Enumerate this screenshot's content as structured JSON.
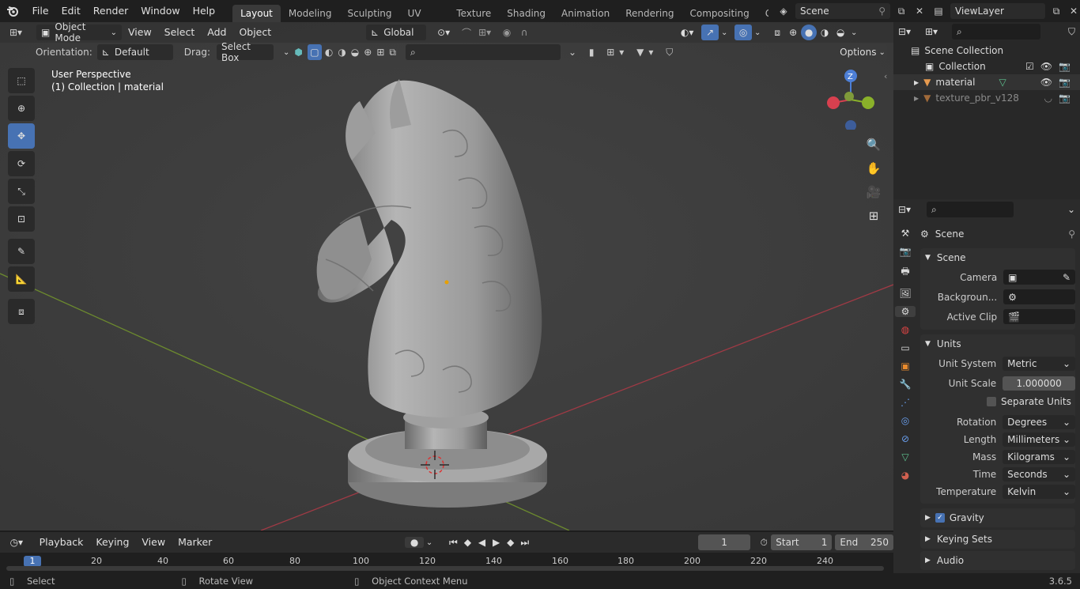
{
  "topbar": {
    "menus": [
      "File",
      "Edit",
      "Render",
      "Window",
      "Help"
    ],
    "workspaces": [
      "Layout",
      "Modeling",
      "Sculpting",
      "UV Editing",
      "Texture Paint",
      "Shading",
      "Animation",
      "Rendering",
      "Compositing",
      "Geometry Noc"
    ],
    "active_workspace": "Layout",
    "scene": "Scene",
    "view_layer": "ViewLayer"
  },
  "viewport": {
    "mode": "Object Mode",
    "menus": [
      "View",
      "Select",
      "Add",
      "Object"
    ],
    "transform_orientation": "Global",
    "orientation_label": "Orientation:",
    "orientation_value": "Default",
    "drag_label": "Drag:",
    "drag_value": "Select Box",
    "options": "Options",
    "overlay_line1": "User Perspective",
    "overlay_line2": "(1) Collection | material",
    "gizmo_axis": "Z"
  },
  "outliner": {
    "root": "Scene Collection",
    "items": [
      {
        "name": "Collection"
      },
      {
        "name": "material"
      },
      {
        "name": "texture_pbr_v128"
      }
    ]
  },
  "properties": {
    "context": "Scene",
    "scene_section": "Scene",
    "camera_label": "Camera",
    "background_label": "Backgroun...",
    "active_clip_label": "Active Clip",
    "units_section": "Units",
    "unit_system_label": "Unit System",
    "unit_system": "Metric",
    "unit_scale_label": "Unit Scale",
    "unit_scale": "1.000000",
    "separate_units": "Separate Units",
    "rotation_label": "Rotation",
    "rotation": "Degrees",
    "length_label": "Length",
    "length": "Millimeters",
    "mass_label": "Mass",
    "mass": "Kilograms",
    "time_label": "Time",
    "time": "Seconds",
    "temperature_label": "Temperature",
    "temperature": "Kelvin",
    "gravity": "Gravity",
    "keying_sets": "Keying Sets",
    "audio": "Audio"
  },
  "timeline": {
    "menus": [
      "Playback",
      "Keying",
      "View",
      "Marker"
    ],
    "current_frame": "1",
    "start_label": "Start",
    "start": "1",
    "end_label": "End",
    "end": "250",
    "ticks": [
      "1",
      "20",
      "40",
      "60",
      "80",
      "100",
      "120",
      "140",
      "160",
      "180",
      "200",
      "220",
      "240"
    ]
  },
  "statusbar": {
    "select": "Select",
    "rotate": "Rotate View",
    "context_menu": "Object Context Menu",
    "version": "3.6.5"
  }
}
